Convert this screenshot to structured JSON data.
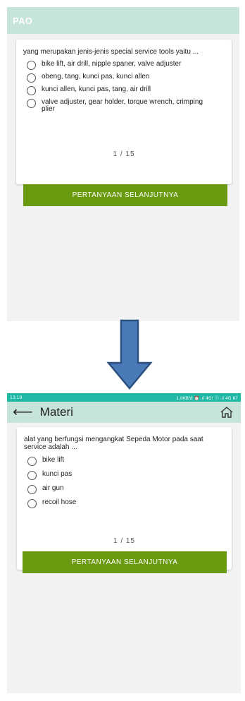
{
  "screen1": {
    "app_title": "PAO",
    "question": "yang merupakan jenis-jenis special service tools yaitu ...",
    "options": [
      "bike lift, air drill, nipple spaner, valve adjuster",
      "obeng, tang, kunci pas, kunci allen",
      "kunci allen, kunci pas, tang, air drill",
      "valve adjuster, gear holder, torque wrench, crimping plier"
    ],
    "counter": "1 / 15",
    "next_button": "PERTANYAAN SELANJUTNYA"
  },
  "screen2": {
    "status": {
      "time": "13:19",
      "right": "1,0KB/d ⏰ .ıl 4G! ⓡ .ıl 4G 87"
    },
    "title": "Materi",
    "question": "alat yang berfungsi mengangkat Sepeda Motor pada saat service adalah ...",
    "options": [
      "bike lift",
      "kunci pas",
      "air gun",
      "recoil hose"
    ],
    "counter": "1 / 15",
    "next_button": "PERTANYAAN SELANJUTNYA"
  },
  "colors": {
    "appbar": "#c6e3dc",
    "statusbar": "#1fb9a5",
    "button": "#6a9a10",
    "arrow_fill": "#4a7ab8",
    "arrow_stroke": "#2b4f80"
  },
  "icons": [
    "radio-icon",
    "back-arrow-icon",
    "home-icon",
    "down-arrow-icon"
  ]
}
